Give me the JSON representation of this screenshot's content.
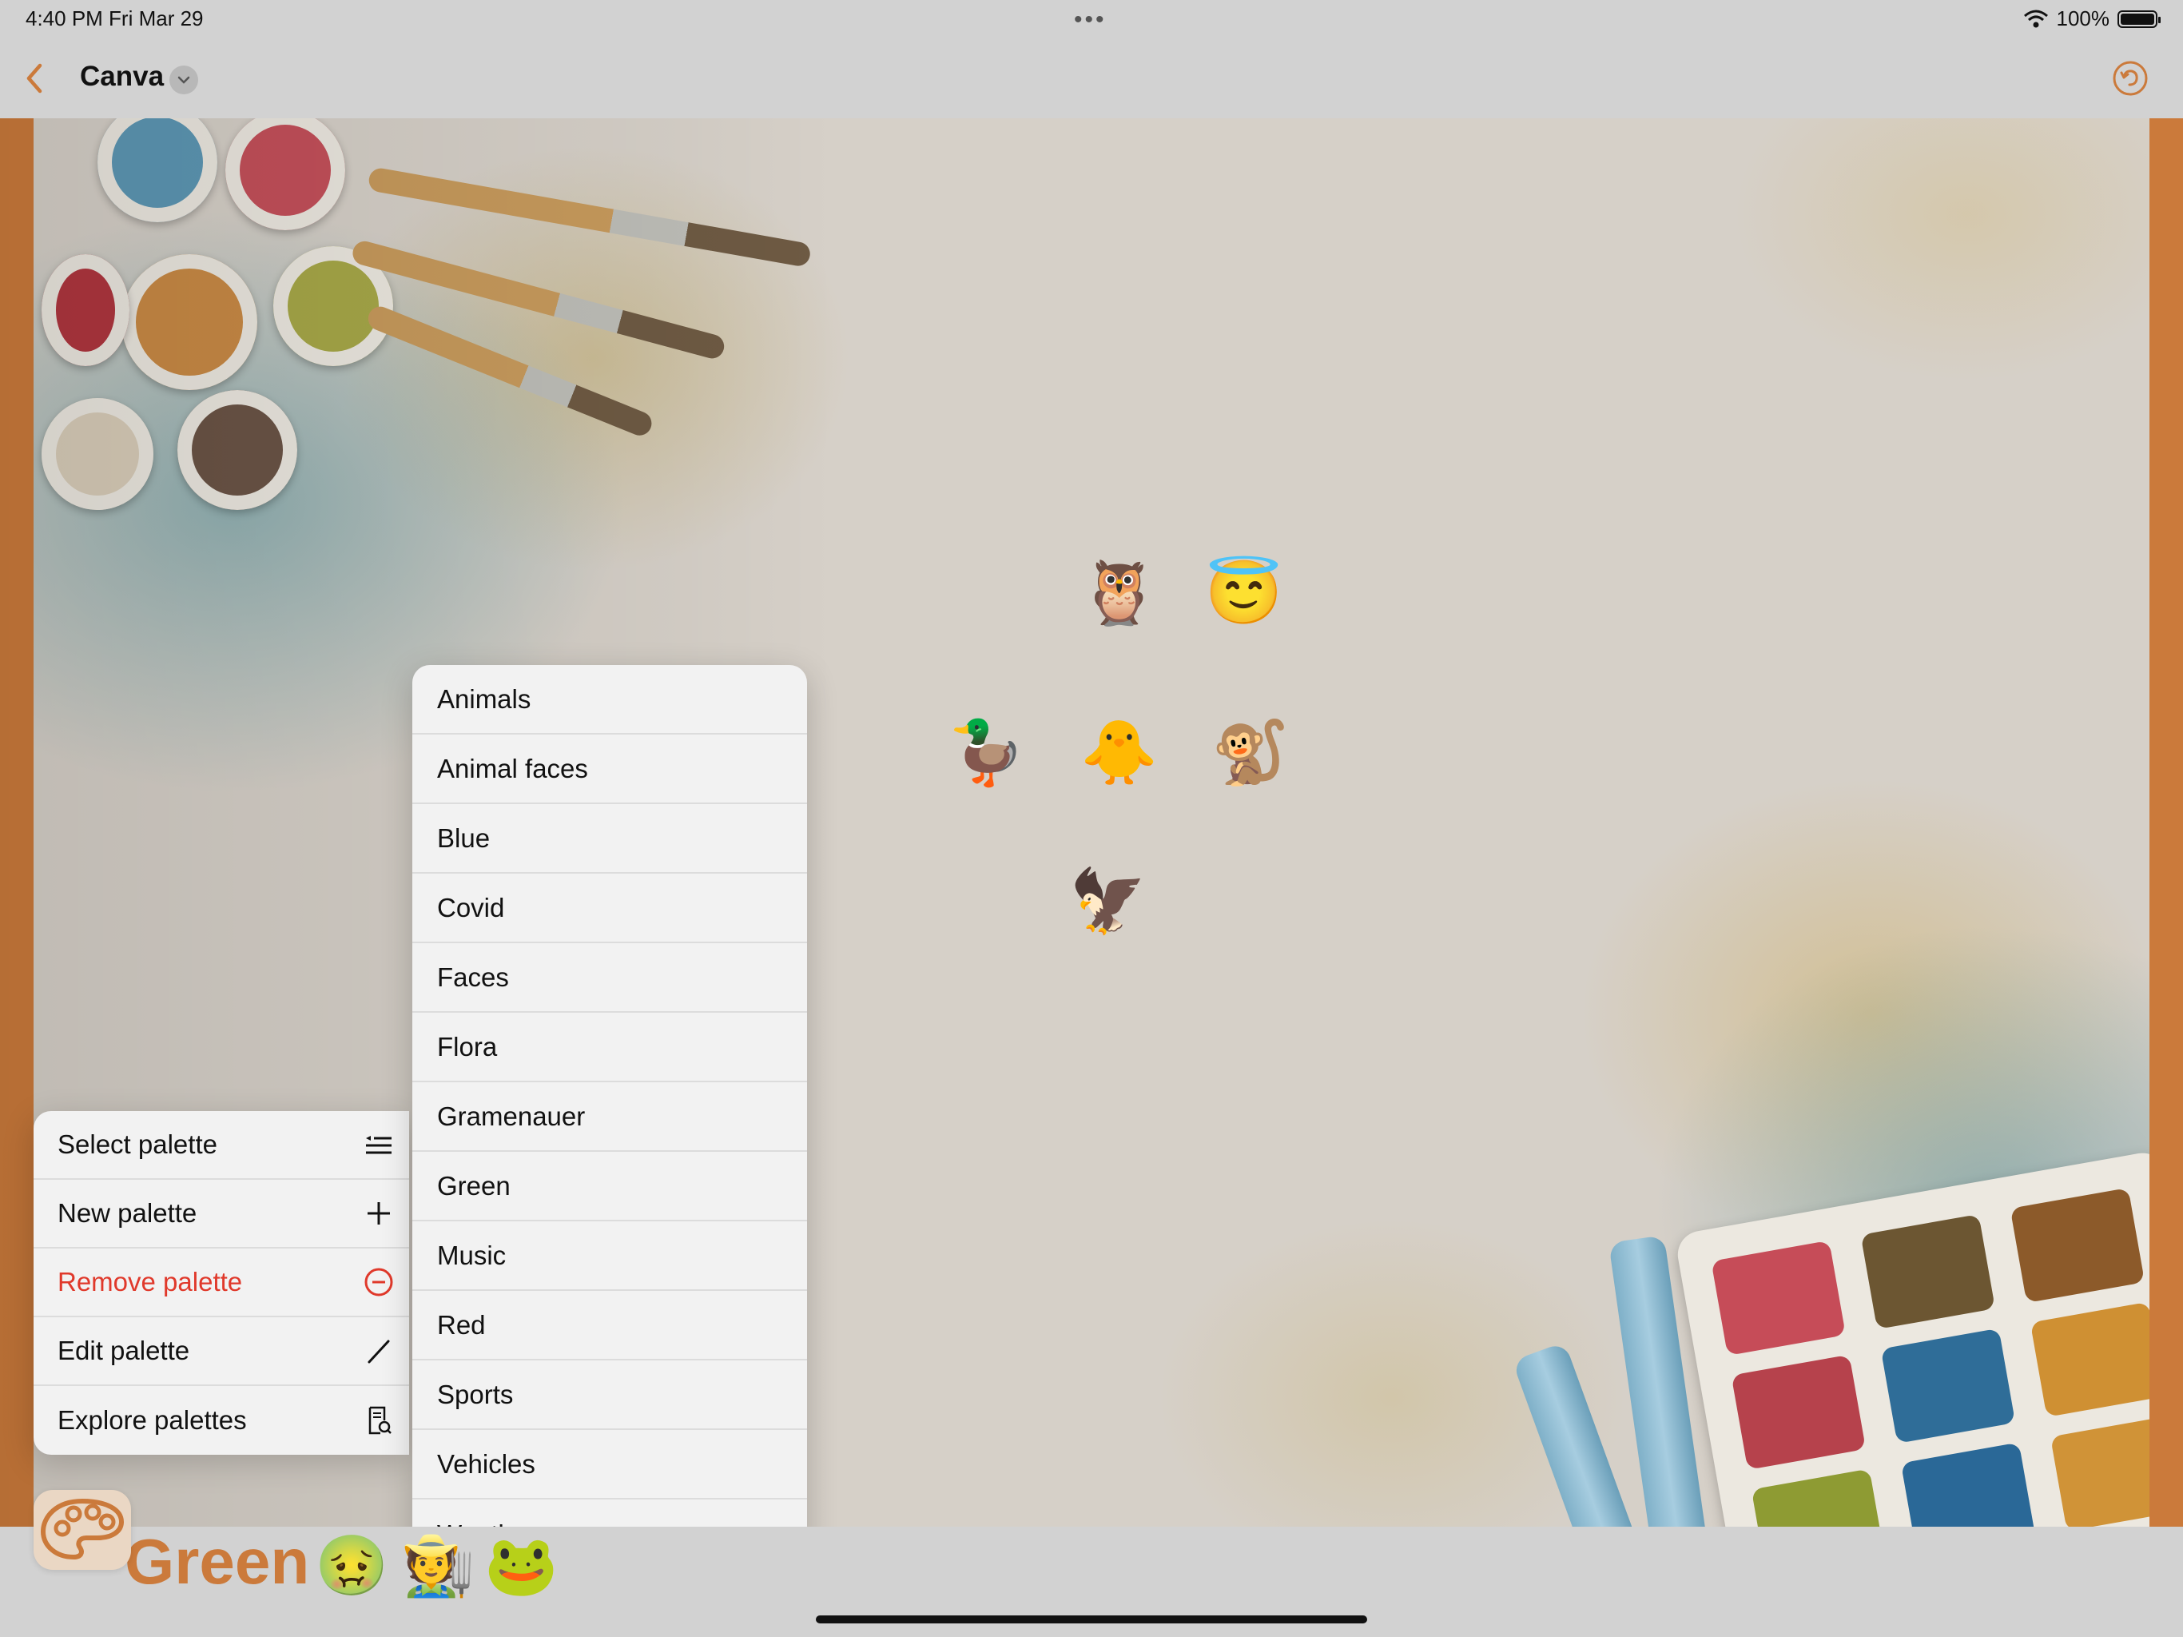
{
  "status_bar": {
    "time_date": "4:40 PM   Fri Mar 29",
    "multitask_dots": "•••",
    "battery_percent": "100%"
  },
  "nav": {
    "title": "Canva",
    "icons": {
      "back": "chevron-left-icon",
      "title_menu": "chevron-down-icon",
      "undo": "undo-icon"
    }
  },
  "canvas": {
    "emojis": [
      "🦉",
      "😇",
      "🦆",
      "🐥",
      "🐒",
      "🦅"
    ]
  },
  "context_menu": {
    "items": [
      {
        "label": "Select palette",
        "icon": "list-select-icon"
      },
      {
        "label": "New palette",
        "icon": "plus-icon"
      },
      {
        "label": "Remove palette",
        "icon": "minus-circle-icon",
        "destructive": true
      },
      {
        "label": "Edit palette",
        "icon": "pencil-icon"
      },
      {
        "label": "Explore palettes",
        "icon": "document-search-icon"
      }
    ]
  },
  "palette_list": {
    "items": [
      "Animals",
      "Animal faces",
      "Blue",
      "Covid",
      "Faces",
      "Flora",
      "Gramenauer",
      "Green",
      "Music",
      "Red",
      "Sports",
      "Vehicles",
      "Weather"
    ]
  },
  "toolbar": {
    "palette_icon": "paint-palette-icon",
    "current_palette": "Green",
    "emojis": [
      "🤢",
      "🧑‍🌾",
      "🐸"
    ]
  },
  "colors": {
    "accent": "#cb7a3b",
    "destructive": "#e0392b",
    "chrome": "#d2d2d2",
    "menu_bg": "#f2f2f2"
  }
}
